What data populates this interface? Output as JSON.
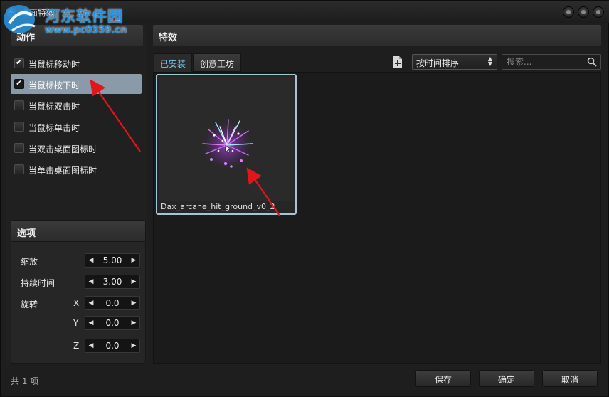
{
  "window": {
    "title": "桌面特效"
  },
  "watermark": {
    "line1": "河东软件园",
    "line2": "www.pc0359.cn"
  },
  "left": {
    "action_header": "动作",
    "triggers": [
      {
        "label": "当鼠标移动时",
        "checked": true,
        "selected": false
      },
      {
        "label": "当鼠标按下时",
        "checked": true,
        "selected": true
      },
      {
        "label": "当鼠标双击时",
        "checked": false,
        "selected": false
      },
      {
        "label": "当鼠标单击时",
        "checked": false,
        "selected": false
      },
      {
        "label": "当双击桌面图标时",
        "checked": false,
        "selected": false
      },
      {
        "label": "当单击桌面图标时",
        "checked": false,
        "selected": false
      }
    ],
    "options": {
      "header": "选项",
      "scale_label": "缩放",
      "scale_value": "5.00",
      "duration_label": "持续时间",
      "duration_value": "3.00",
      "rotation_label": "旋转",
      "rot_x_label": "X",
      "rot_x_value": "0.0",
      "rot_y_label": "Y",
      "rot_y_value": "0.0",
      "rot_z_label": "Z",
      "rot_z_value": "0.0"
    }
  },
  "right": {
    "header": "特效",
    "tabs": [
      {
        "label": "已安装",
        "active": true
      },
      {
        "label": "创意工坊",
        "active": false
      }
    ],
    "sort_value": "按时间排序",
    "search_placeholder": "搜索...",
    "effects": [
      {
        "name": "Dax_arcane_hit_ground_v0_2",
        "selected": true
      }
    ]
  },
  "footer": {
    "count_text": "共 1 项",
    "save": "保存",
    "ok": "确定",
    "cancel": "取消"
  },
  "colors": {
    "accent_tab": "#7ec4ea",
    "selection": "#8a9aa8",
    "card_border": "#a5c4d6",
    "annotation_arrow": "#e0161b"
  }
}
